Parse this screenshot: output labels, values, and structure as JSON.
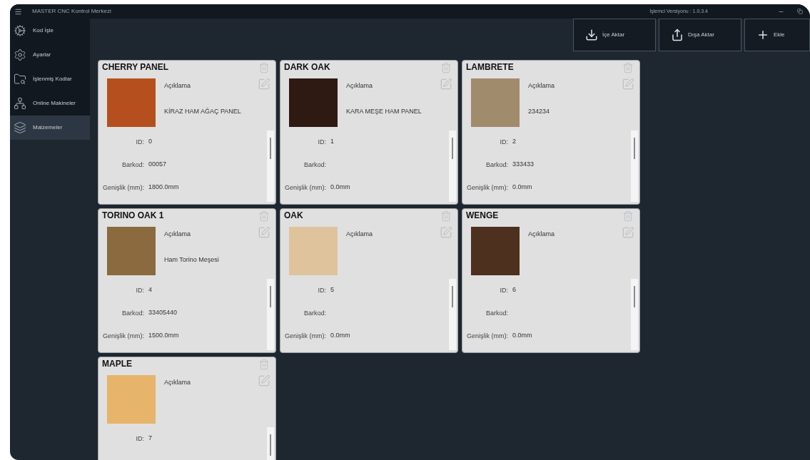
{
  "window": {
    "title": "MASTER CNC Kontrol Merkezi",
    "version": "İşlemci Versiyonu : 1.0.3.4"
  },
  "sidebar": {
    "items": [
      {
        "kind": "gears",
        "label": "Kod İşle",
        "selected": false
      },
      {
        "kind": "settings",
        "label": "Ayarlar",
        "selected": false
      },
      {
        "kind": "folder",
        "label": "İşlenmiş Kodlar",
        "selected": false
      },
      {
        "kind": "network",
        "label": "Online Makineler",
        "selected": false
      },
      {
        "kind": "layers",
        "label": "Malzemeler",
        "selected": true
      }
    ]
  },
  "toolbar": [
    {
      "kind": "import",
      "label": "İçe Aktar"
    },
    {
      "kind": "export",
      "label": "Dışa Aktar"
    },
    {
      "kind": "add",
      "label": "Ekle"
    }
  ],
  "materials": [
    {
      "name": "CHERRY PANEL",
      "color": "#b5501e",
      "description_label": "Açıklama",
      "description": "KİRAZ HAM AĞAÇ PANEL",
      "fields": [
        {
          "label": "ID:",
          "value": "0"
        },
        {
          "label": "Barkod:",
          "value": "00057"
        },
        {
          "label": "Genişlik (mm):",
          "value": "1800.0mm"
        }
      ]
    },
    {
      "name": "DARK OAK",
      "color": "#2e1a12",
      "description_label": "Açıklama",
      "description": "KARA MEŞE HAM PANEL",
      "fields": [
        {
          "label": "ID:",
          "value": "1"
        },
        {
          "label": "Barkod:"
        },
        {
          "label": "Genişlik (mm):",
          "value": "0.0mm"
        }
      ]
    },
    {
      "name": "LAMBRETE",
      "color": "#a18b6d",
      "description_label": "Açıklama",
      "description": "234234",
      "fields": [
        {
          "label": "ID:",
          "value": "2"
        },
        {
          "label": "Barkod:",
          "value": "333433"
        },
        {
          "label": "Genişlik (mm):",
          "value": "0.0mm"
        }
      ]
    },
    {
      "name": "TORINO OAK 1",
      "color": "#8a6a3e",
      "description_label": "Açıklama",
      "description": "Ham Torino Meşesi",
      "fields": [
        {
          "label": "ID:",
          "value": "4"
        },
        {
          "label": "Barkod:",
          "value": "33405440"
        },
        {
          "label": "Genişlik (mm):",
          "value": "1500.0mm"
        }
      ]
    },
    {
      "name": "OAK",
      "color": "#dfc39c",
      "description_label": "Açıklama",
      "fields": [
        {
          "label": "ID:",
          "value": "5"
        },
        {
          "label": "Barkod:"
        },
        {
          "label": "Genişlik (mm):",
          "value": "0.0mm"
        }
      ]
    },
    {
      "name": "WENGE",
      "color": "#4d301e",
      "description_label": "Açıklama",
      "fields": [
        {
          "label": "ID:",
          "value": "6"
        },
        {
          "label": "Barkod:"
        },
        {
          "label": "Genişlik (mm):",
          "value": "0.0mm"
        }
      ]
    },
    {
      "name": "MAPLE",
      "color": "#e6b46a",
      "description_label": "Açıklama",
      "fields": [
        {
          "label": "ID:",
          "value": "7"
        }
      ]
    }
  ]
}
